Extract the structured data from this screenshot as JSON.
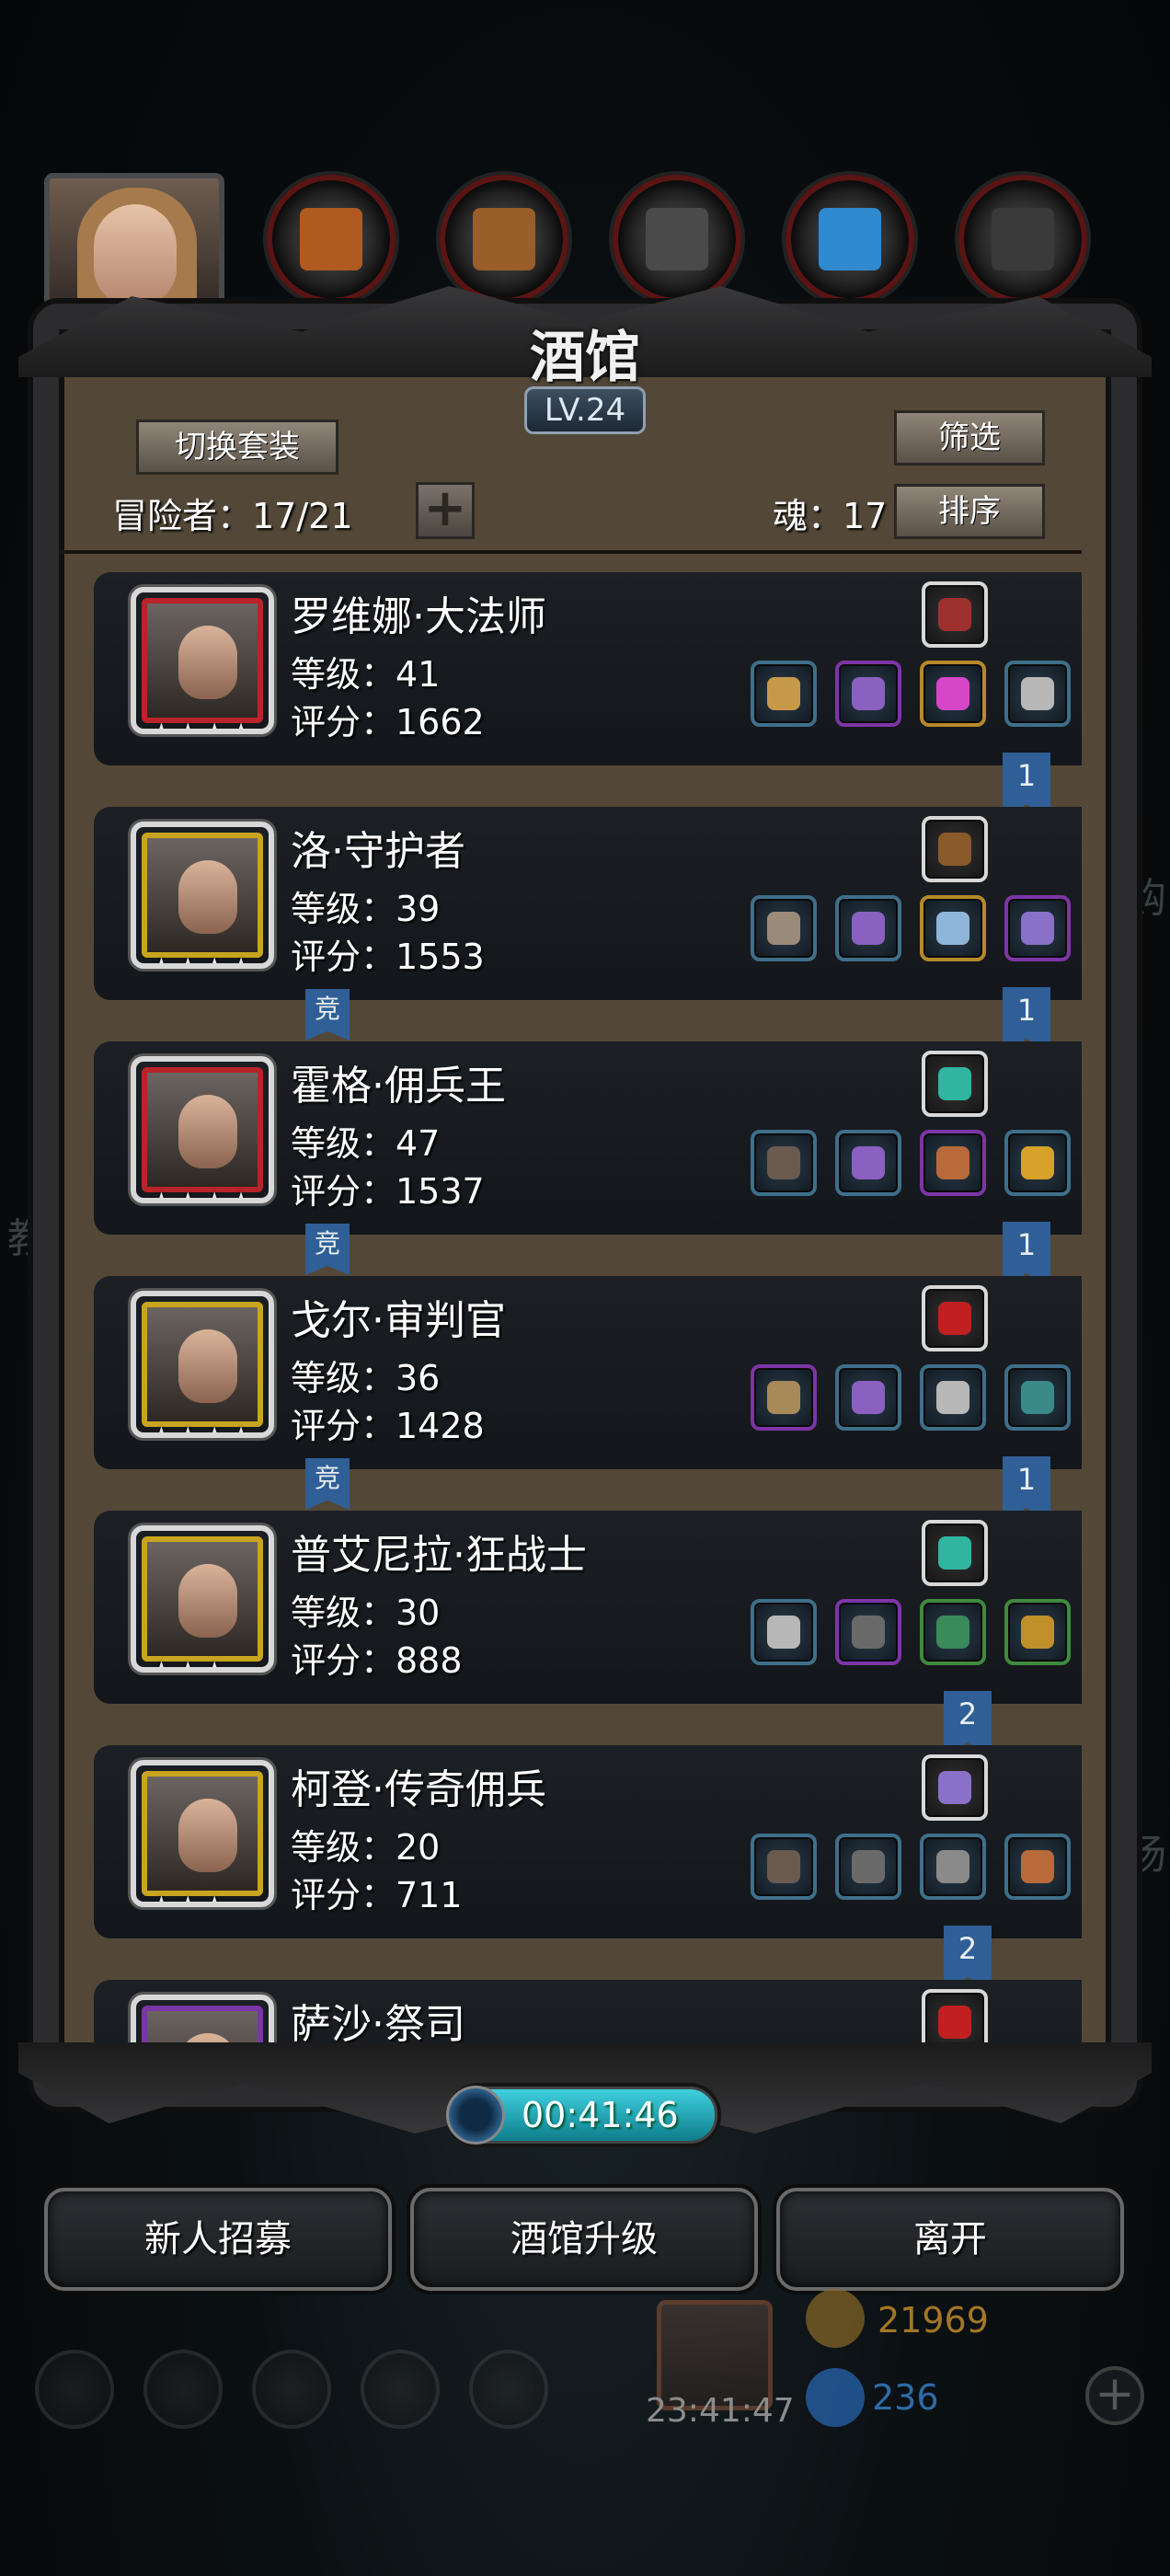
{
  "header": {
    "title": "酒馆",
    "level": "LV.24",
    "switch_outfit_label": "切换套装",
    "filter_label": "筛选",
    "sort_label": "排序",
    "adventurers_text": "冒险者：17/21",
    "soul_text": "魂：17",
    "add_icon": "plus-icon"
  },
  "top_tabs": [
    {
      "name": "portrait-tab",
      "icon": "girl-portrait",
      "color": "#a67a4c"
    },
    {
      "name": "leather-tab",
      "icon": "leather-armor-icon",
      "color": "#b05a22"
    },
    {
      "name": "wood-tab",
      "icon": "wood-planks-icon",
      "color": "#9a5e2a"
    },
    {
      "name": "iron-tab",
      "icon": "iron-ingot-icon",
      "color": "#4a4a4a"
    },
    {
      "name": "crystal-tab",
      "icon": "blue-crystal-icon",
      "color": "#2f8ad0"
    },
    {
      "name": "steel-tab",
      "icon": "steel-ingot-icon",
      "color": "#3a3a3a"
    }
  ],
  "heroes": [
    {
      "name": "罗维娜·大法师",
      "level": "等级：41",
      "score": "评分：1662",
      "stars": "★★★★",
      "frame": "#b8242a",
      "top_item": "#9e3030",
      "badge": "1",
      "badge_kind": "ribbon",
      "jing": "",
      "gear": [
        {
          "c": "",
          "g": "#c79a4a"
        },
        {
          "c": "purple",
          "g": "#8a60c0"
        },
        {
          "c": "gold",
          "g": "#d646c8"
        },
        {
          "c": "",
          "g": "#b8b8b8"
        }
      ]
    },
    {
      "name": "洛·守护者",
      "level": "等级：39",
      "score": "评分：1553",
      "stars": "★★★★",
      "frame": "#c9a51f",
      "top_item": "#8a5a2a",
      "badge": "1",
      "badge_kind": "ribbon",
      "jing": "竞",
      "gear": [
        {
          "c": "",
          "g": "#9a8a7a"
        },
        {
          "c": "",
          "g": "#8a60c0"
        },
        {
          "c": "gold",
          "g": "#8fb5d8"
        },
        {
          "c": "purple",
          "g": "#8a70c8"
        }
      ]
    },
    {
      "name": "霍格·佣兵王",
      "level": "等级：47",
      "score": "评分：1537",
      "stars": "★★★★",
      "frame": "#b8242a",
      "top_item": "#2fb5a0",
      "badge": "1",
      "badge_kind": "ribbon",
      "jing": "竞",
      "gear": [
        {
          "c": "",
          "g": "#6a5a50"
        },
        {
          "c": "",
          "g": "#8a60c0"
        },
        {
          "c": "purple",
          "g": "#b86a3a"
        },
        {
          "c": "",
          "g": "#d6a22a"
        }
      ]
    },
    {
      "name": "戈尔·审判官",
      "level": "等级：36",
      "score": "评分：1428",
      "stars": "★★★★",
      "frame": "#c9a51f",
      "top_item": "#c02020",
      "badge": "1",
      "badge_kind": "ribbon",
      "jing": "竞",
      "gear": [
        {
          "c": "purple",
          "g": "#a88a5a"
        },
        {
          "c": "",
          "g": "#8a60c0"
        },
        {
          "c": "",
          "g": "#b8b8b8"
        },
        {
          "c": "",
          "g": "#3a8a8a"
        }
      ]
    },
    {
      "name": "普艾尼拉·狂战士",
      "level": "等级：30",
      "score": "评分：888",
      "stars": "★★★",
      "frame": "#c9a51f",
      "top_item": "#2fb5a0",
      "badge": "2",
      "badge_kind": "ribbon",
      "jing": "",
      "gear": [
        {
          "c": "",
          "g": "#b8b8b8"
        },
        {
          "c": "purple",
          "g": "#6a6a6a"
        },
        {
          "c": "green",
          "g": "#3a8a5a"
        },
        {
          "c": "green",
          "g": "#c0902a"
        }
      ]
    },
    {
      "name": "柯登·传奇佣兵",
      "level": "等级：20",
      "score": "评分：711",
      "stars": "★★★",
      "frame": "#c9a51f",
      "top_item": "#8a70c8",
      "badge": "2",
      "badge_kind": "ribbon",
      "jing": "",
      "gear": [
        {
          "c": "",
          "g": "#6a5a50"
        },
        {
          "c": "",
          "g": "#6a6a6a"
        },
        {
          "c": "",
          "g": "#8a8a8a"
        },
        {
          "c": "",
          "g": "#b86a3a"
        }
      ]
    },
    {
      "name": "萨沙·祭司",
      "level": "",
      "score": "",
      "stars": "",
      "frame": "#7a35a6",
      "top_item": "#c02020",
      "badge": "",
      "badge_kind": "",
      "jing": "",
      "gear": []
    }
  ],
  "timer": {
    "time": "00:41:46"
  },
  "bottom_buttons": {
    "recruit": "新人招募",
    "upgrade": "酒馆升级",
    "leave": "离开"
  },
  "hud": {
    "gift_timer": "23:41:47",
    "gold": "21969",
    "gems": "236",
    "left_text": "教",
    "right_text_1": "购",
    "right_text_2": "扬"
  },
  "colors": {
    "accent_cyan": "#3fd0df",
    "ribbon_blue": "#2f5f96",
    "gold_text": "#d89a2a",
    "gem_text": "#3a8ad8"
  }
}
